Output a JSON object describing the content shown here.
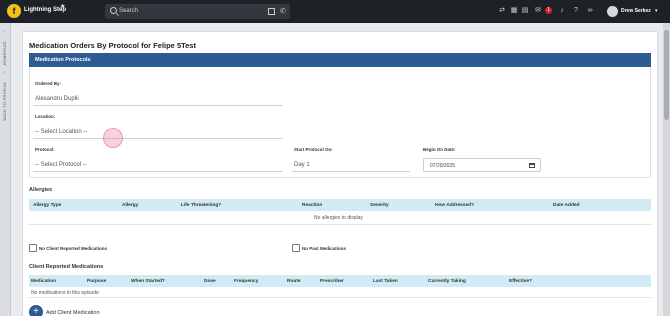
{
  "app": {
    "brand": "Lightning Step",
    "logo_letter": "f"
  },
  "search": {
    "placeholder": "Search"
  },
  "header": {
    "notification_count": "1",
    "user_name": "Drew Serkez"
  },
  "sidebar": {
    "homepage": "HOMEPAGE",
    "back_to_profile": "BACK TO PROFILE"
  },
  "page": {
    "title": "Medication Orders By Protocol for Felipe 5Test",
    "section_title": "Medication Protocols"
  },
  "form": {
    "ordered_by_label": "Ordered By:",
    "ordered_by_value": "Alexandru Duplii",
    "location_label": "Location:",
    "location_value": "-- Select Location --",
    "protocol_label": "Protocol:",
    "protocol_value": "-- Select Protocol --",
    "start_label": "Start Protocol On:",
    "start_value": "Day 1",
    "begin_label": "Begin On Date:",
    "begin_value": "07/20/2025"
  },
  "allergies": {
    "title": "Allergies",
    "columns": [
      "Allergy Type",
      "Allergy",
      "Life Threatening?",
      "Reaction",
      "Severity",
      "How Addressed?",
      "Date Added"
    ],
    "empty": "No allergies to display"
  },
  "checkboxes": {
    "no_client_reported": "No Client Reported Medications",
    "no_past": "No Past Medications"
  },
  "client_meds": {
    "title": "Client Reported Medications",
    "columns": [
      "Medication",
      "Purpose",
      "When Started?",
      "Dose",
      "Frequency",
      "Route",
      "Prescriber",
      "Last Taken",
      "Currently Taking",
      "Effective?"
    ],
    "empty": "No medications in this episode"
  },
  "add_client_medication": "Add Client Medication",
  "colors": {
    "topbar": "#1e2227",
    "header_blue": "#2e5b93",
    "table_head": "#d1eaf3",
    "badge": "#d9252a"
  },
  "icons": [
    "star-icon",
    "search-icon",
    "calendar-icon",
    "phone-icon",
    "message-icon",
    "bell-icon",
    "help-icon",
    "link-icon",
    "plus-icon"
  ]
}
